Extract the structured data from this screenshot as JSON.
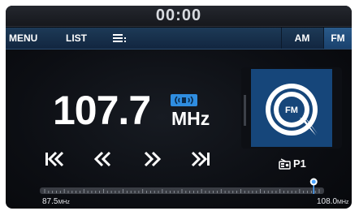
{
  "status": {
    "time": "00:00"
  },
  "menu": {
    "menu_label": "MENU",
    "list_label": "LIST",
    "options_icon": "list-options-icon",
    "am_label": "AM",
    "fm_label": "FM",
    "active_band": "FM"
  },
  "radio": {
    "frequency": "107.7",
    "unit": "MHz",
    "hd_icon": "hd-radio-icon",
    "preset_icon": "radio-preset-icon",
    "preset_label": "P1",
    "station_logo_text": "FM"
  },
  "controls": {
    "skip_back_icon": "skip-back-icon",
    "seek_back_icon": "seek-back-icon",
    "seek_forward_icon": "seek-forward-icon",
    "skip_forward_icon": "skip-forward-icon"
  },
  "tuner": {
    "min_value": "87.5",
    "min_unit": "MHz",
    "max_value": "108.0",
    "max_unit": "MHz",
    "position_fraction": 0.98
  },
  "colors": {
    "accent": "#1f4d80",
    "hd_badge": "#2f8de0",
    "marker": "#4aa3ff"
  }
}
